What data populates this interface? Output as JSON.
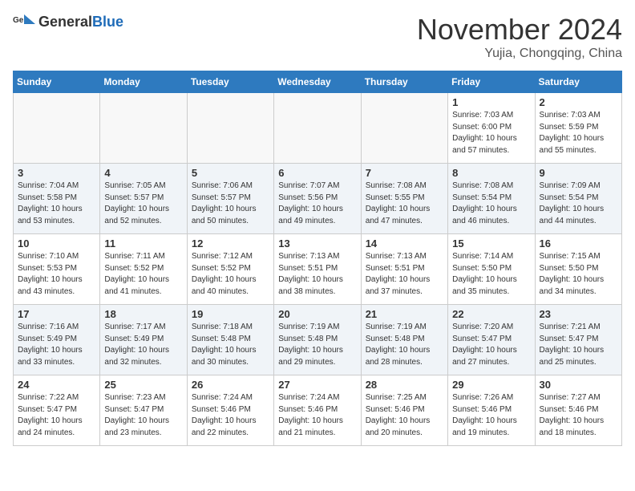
{
  "header": {
    "logo_general": "General",
    "logo_blue": "Blue",
    "month": "November 2024",
    "location": "Yujia, Chongqing, China"
  },
  "days_of_week": [
    "Sunday",
    "Monday",
    "Tuesday",
    "Wednesday",
    "Thursday",
    "Friday",
    "Saturday"
  ],
  "weeks": [
    [
      {
        "day": "",
        "info": ""
      },
      {
        "day": "",
        "info": ""
      },
      {
        "day": "",
        "info": ""
      },
      {
        "day": "",
        "info": ""
      },
      {
        "day": "",
        "info": ""
      },
      {
        "day": "1",
        "info": "Sunrise: 7:03 AM\nSunset: 6:00 PM\nDaylight: 10 hours and 57 minutes."
      },
      {
        "day": "2",
        "info": "Sunrise: 7:03 AM\nSunset: 5:59 PM\nDaylight: 10 hours and 55 minutes."
      }
    ],
    [
      {
        "day": "3",
        "info": "Sunrise: 7:04 AM\nSunset: 5:58 PM\nDaylight: 10 hours and 53 minutes."
      },
      {
        "day": "4",
        "info": "Sunrise: 7:05 AM\nSunset: 5:57 PM\nDaylight: 10 hours and 52 minutes."
      },
      {
        "day": "5",
        "info": "Sunrise: 7:06 AM\nSunset: 5:57 PM\nDaylight: 10 hours and 50 minutes."
      },
      {
        "day": "6",
        "info": "Sunrise: 7:07 AM\nSunset: 5:56 PM\nDaylight: 10 hours and 49 minutes."
      },
      {
        "day": "7",
        "info": "Sunrise: 7:08 AM\nSunset: 5:55 PM\nDaylight: 10 hours and 47 minutes."
      },
      {
        "day": "8",
        "info": "Sunrise: 7:08 AM\nSunset: 5:54 PM\nDaylight: 10 hours and 46 minutes."
      },
      {
        "day": "9",
        "info": "Sunrise: 7:09 AM\nSunset: 5:54 PM\nDaylight: 10 hours and 44 minutes."
      }
    ],
    [
      {
        "day": "10",
        "info": "Sunrise: 7:10 AM\nSunset: 5:53 PM\nDaylight: 10 hours and 43 minutes."
      },
      {
        "day": "11",
        "info": "Sunrise: 7:11 AM\nSunset: 5:52 PM\nDaylight: 10 hours and 41 minutes."
      },
      {
        "day": "12",
        "info": "Sunrise: 7:12 AM\nSunset: 5:52 PM\nDaylight: 10 hours and 40 minutes."
      },
      {
        "day": "13",
        "info": "Sunrise: 7:13 AM\nSunset: 5:51 PM\nDaylight: 10 hours and 38 minutes."
      },
      {
        "day": "14",
        "info": "Sunrise: 7:13 AM\nSunset: 5:51 PM\nDaylight: 10 hours and 37 minutes."
      },
      {
        "day": "15",
        "info": "Sunrise: 7:14 AM\nSunset: 5:50 PM\nDaylight: 10 hours and 35 minutes."
      },
      {
        "day": "16",
        "info": "Sunrise: 7:15 AM\nSunset: 5:50 PM\nDaylight: 10 hours and 34 minutes."
      }
    ],
    [
      {
        "day": "17",
        "info": "Sunrise: 7:16 AM\nSunset: 5:49 PM\nDaylight: 10 hours and 33 minutes."
      },
      {
        "day": "18",
        "info": "Sunrise: 7:17 AM\nSunset: 5:49 PM\nDaylight: 10 hours and 32 minutes."
      },
      {
        "day": "19",
        "info": "Sunrise: 7:18 AM\nSunset: 5:48 PM\nDaylight: 10 hours and 30 minutes."
      },
      {
        "day": "20",
        "info": "Sunrise: 7:19 AM\nSunset: 5:48 PM\nDaylight: 10 hours and 29 minutes."
      },
      {
        "day": "21",
        "info": "Sunrise: 7:19 AM\nSunset: 5:48 PM\nDaylight: 10 hours and 28 minutes."
      },
      {
        "day": "22",
        "info": "Sunrise: 7:20 AM\nSunset: 5:47 PM\nDaylight: 10 hours and 27 minutes."
      },
      {
        "day": "23",
        "info": "Sunrise: 7:21 AM\nSunset: 5:47 PM\nDaylight: 10 hours and 25 minutes."
      }
    ],
    [
      {
        "day": "24",
        "info": "Sunrise: 7:22 AM\nSunset: 5:47 PM\nDaylight: 10 hours and 24 minutes."
      },
      {
        "day": "25",
        "info": "Sunrise: 7:23 AM\nSunset: 5:47 PM\nDaylight: 10 hours and 23 minutes."
      },
      {
        "day": "26",
        "info": "Sunrise: 7:24 AM\nSunset: 5:46 PM\nDaylight: 10 hours and 22 minutes."
      },
      {
        "day": "27",
        "info": "Sunrise: 7:24 AM\nSunset: 5:46 PM\nDaylight: 10 hours and 21 minutes."
      },
      {
        "day": "28",
        "info": "Sunrise: 7:25 AM\nSunset: 5:46 PM\nDaylight: 10 hours and 20 minutes."
      },
      {
        "day": "29",
        "info": "Sunrise: 7:26 AM\nSunset: 5:46 PM\nDaylight: 10 hours and 19 minutes."
      },
      {
        "day": "30",
        "info": "Sunrise: 7:27 AM\nSunset: 5:46 PM\nDaylight: 10 hours and 18 minutes."
      }
    ]
  ]
}
